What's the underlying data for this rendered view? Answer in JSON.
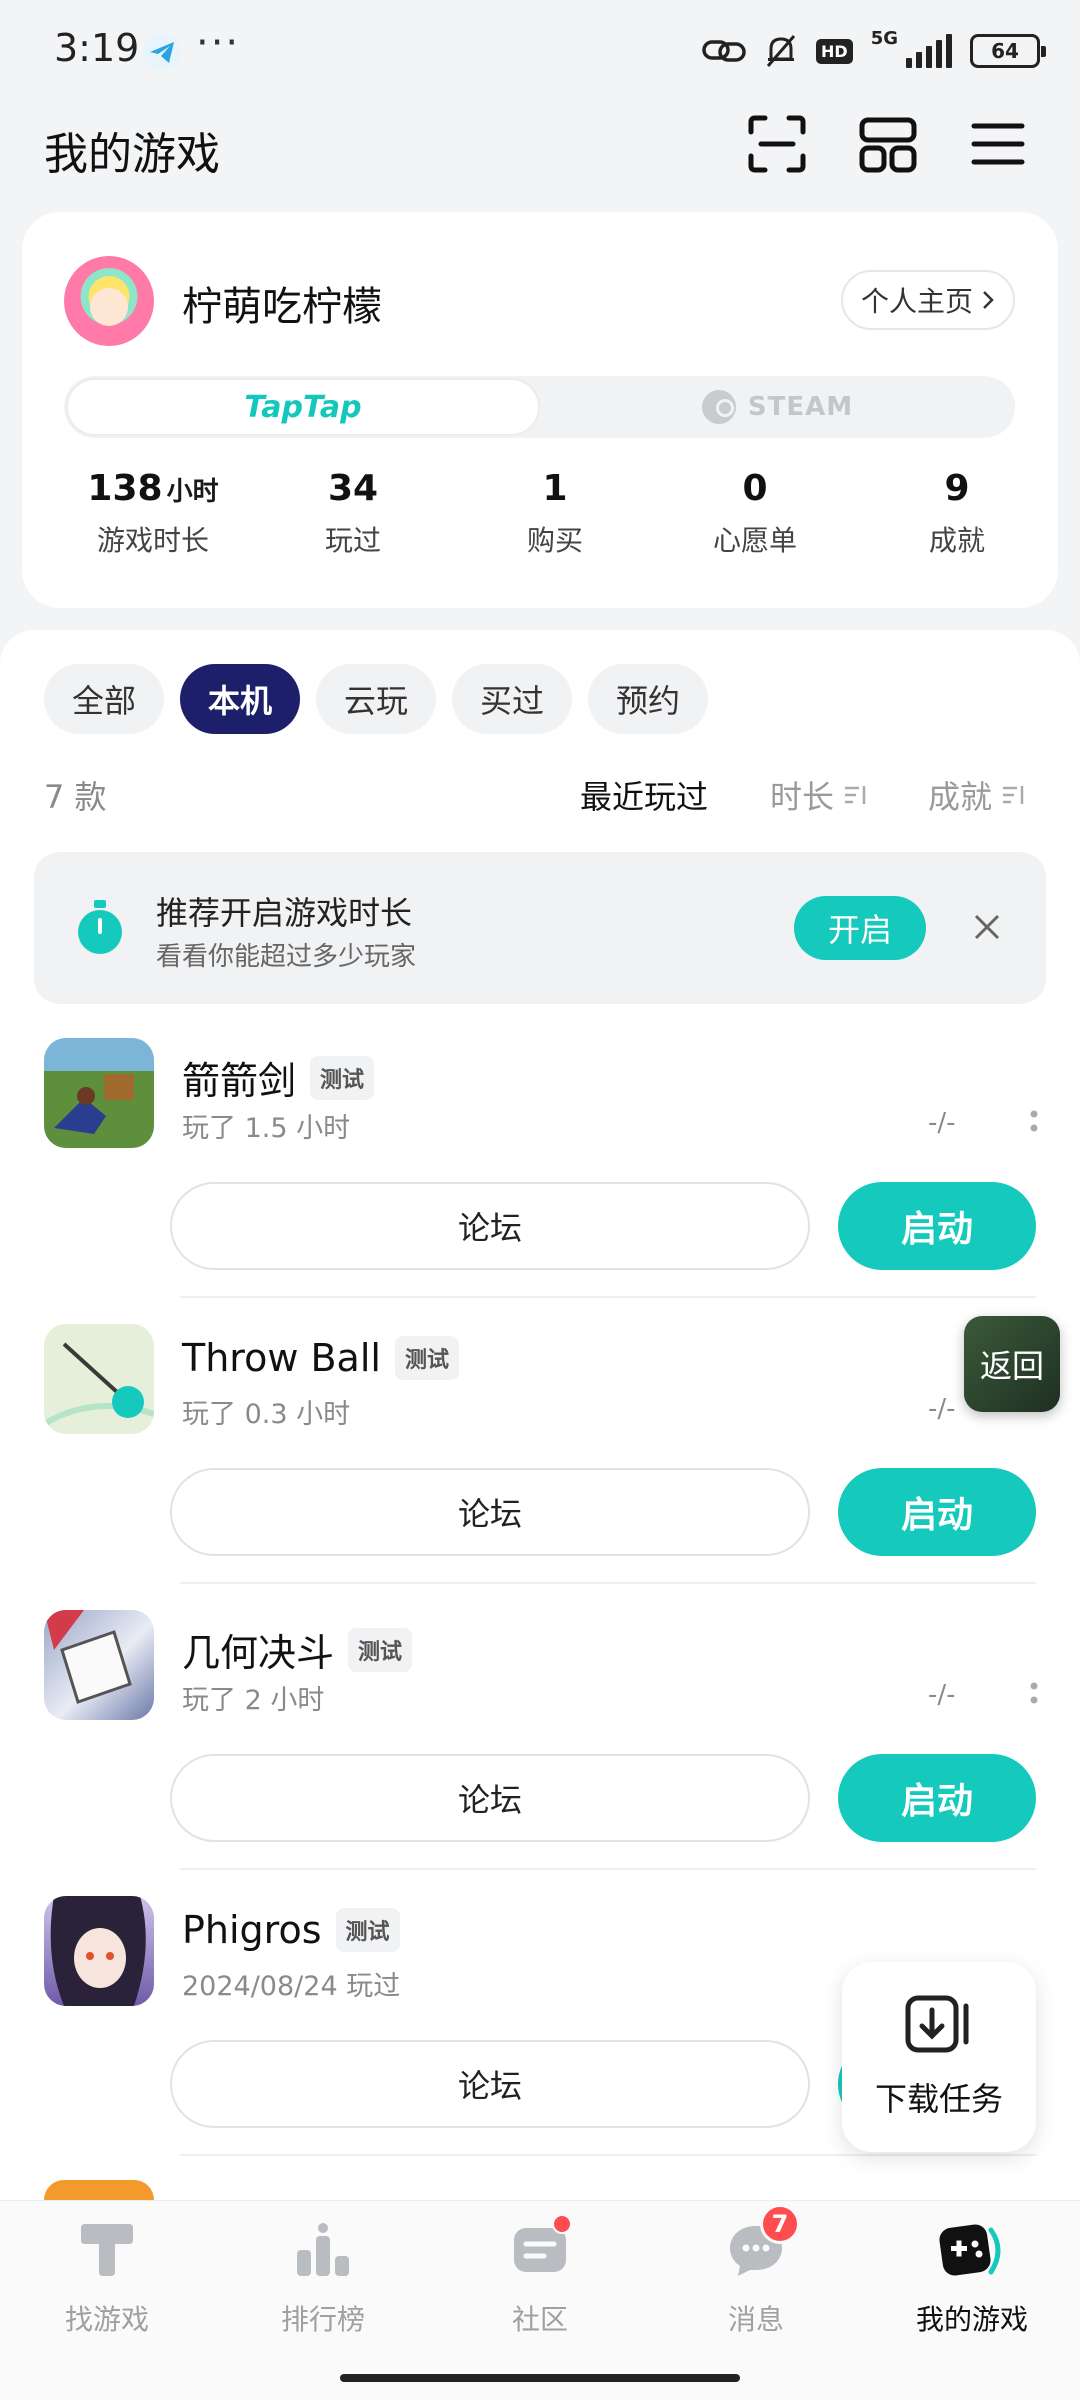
{
  "status_bar": {
    "time": "3:19",
    "dots": "···",
    "network": "5G",
    "hd": "HD",
    "battery": "64"
  },
  "header": {
    "title": "我的游戏",
    "icons": [
      "scan-icon",
      "grid-icon",
      "menu-icon"
    ]
  },
  "profile": {
    "username": "柠萌吃柠檬",
    "profile_link": "个人主页",
    "platforms": {
      "taptap": "TapTap",
      "steam": "STEAM"
    },
    "stats": [
      {
        "value": "138",
        "unit": "小时",
        "label": "游戏时长"
      },
      {
        "value": "34",
        "unit": "",
        "label": "玩过"
      },
      {
        "value": "1",
        "unit": "",
        "label": "购买"
      },
      {
        "value": "0",
        "unit": "",
        "label": "心愿单"
      },
      {
        "value": "9",
        "unit": "",
        "label": "成就"
      }
    ]
  },
  "filters": {
    "tabs": [
      "全部",
      "本机",
      "云玩",
      "买过",
      "预约"
    ],
    "active": "本机"
  },
  "list_header": {
    "count": "7 款",
    "sort_options": [
      "最近玩过",
      "时长",
      "成就"
    ],
    "active_sort": "最近玩过"
  },
  "promo": {
    "title": "推荐开启游戏时长",
    "subtitle": "看看你能超过多少玩家",
    "button": "开启"
  },
  "games": [
    {
      "name": "箭箭剑",
      "badge": "测试",
      "played": "玩了 1.5 小时",
      "meta": "-/-",
      "forum": "论坛",
      "launch": "启动"
    },
    {
      "name": "Throw Ball",
      "badge": "测试",
      "played": "玩了 0.3 小时",
      "meta": "-/-",
      "forum": "论坛",
      "launch": "启动"
    },
    {
      "name": "几何决斗",
      "badge": "测试",
      "played": "玩了 2 小时",
      "meta": "-/-",
      "forum": "论坛",
      "launch": "启动"
    },
    {
      "name": "Phigros",
      "badge": "测试",
      "played": "2024/08/24 玩过",
      "meta": "",
      "forum": "论坛",
      "launch": ""
    }
  ],
  "floating": {
    "back": "返回",
    "download": "下载任务"
  },
  "bottom_nav": {
    "items": [
      {
        "label": "找游戏",
        "icon": "find-games-icon"
      },
      {
        "label": "排行榜",
        "icon": "leaderboard-icon"
      },
      {
        "label": "社区",
        "icon": "community-icon"
      },
      {
        "label": "消息",
        "icon": "messages-icon",
        "badge": "7"
      },
      {
        "label": "我的游戏",
        "icon": "my-games-icon"
      }
    ],
    "active": "我的游戏"
  },
  "colors": {
    "accent": "#15c9bd",
    "active_tab": "#1e1f6b",
    "badge": "#ff4d4f"
  }
}
